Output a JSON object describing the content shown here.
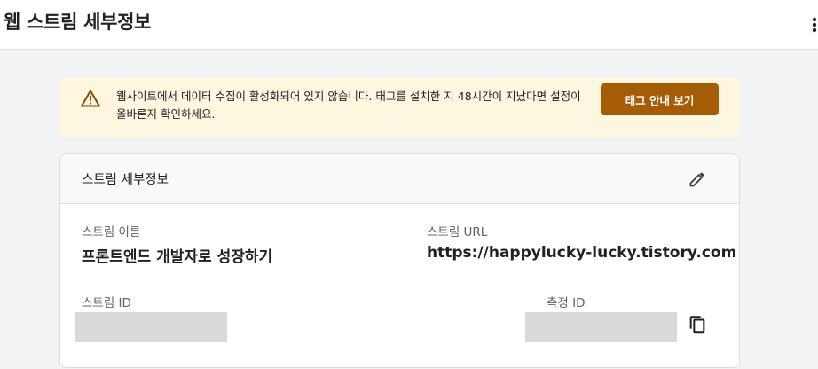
{
  "header": {
    "title": "웹 스트림 세부정보",
    "more_icon": "more-vert-icon"
  },
  "banner": {
    "icon": "warning-icon",
    "message": "웹사이트에서 데이터 수집이 활성화되어 있지 않습니다. 태그를 설치한 지 48시간이 지났다면 설정이 올바른지 확인하세요.",
    "button_label": "태그 안내 보기",
    "button_color": "#a65b05",
    "background_color": "#fef7e0"
  },
  "card": {
    "title": "스트림 세부정보",
    "edit_icon": "pencil-icon",
    "fields": {
      "stream_name_label": "스트림 이름",
      "stream_name_value": "프론트엔드 개발자로 성장하기",
      "stream_url_label": "스트림 URL",
      "stream_url_value": "https://happylucky-lucky.tistory.com",
      "stream_id_label": "스트림 ID",
      "measurement_id_label": "측정 ID"
    },
    "copy_icon": "copy-icon"
  }
}
